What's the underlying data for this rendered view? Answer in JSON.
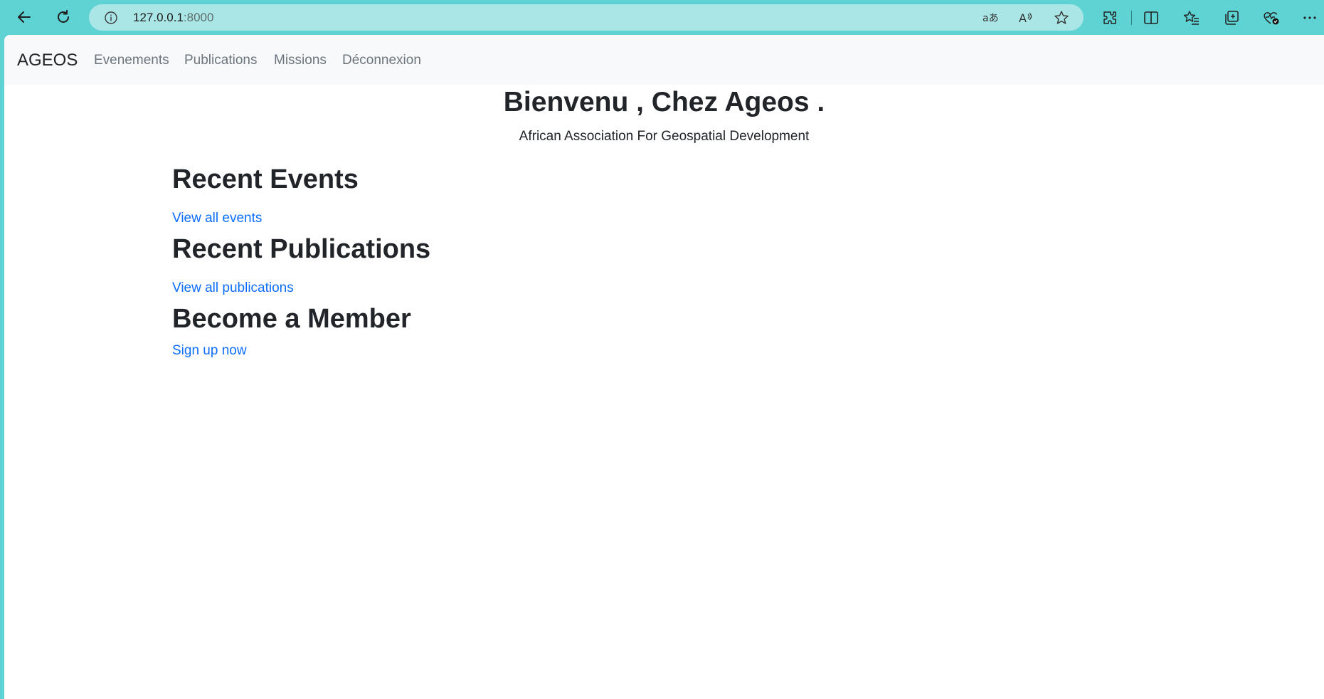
{
  "browser": {
    "url_host": "127.0.0.1",
    "url_port": ":8000"
  },
  "navbar": {
    "brand": "AGEOS",
    "links": [
      "Evenements",
      "Publications",
      "Missions",
      "Déconnexion"
    ]
  },
  "hero": {
    "title": "Bienvenu , Chez Ageos .",
    "subtitle": "African Association For Geospatial Development"
  },
  "sections": {
    "events": {
      "title": "Recent Events",
      "link": "View all events"
    },
    "publications": {
      "title": "Recent Publications",
      "link": "View all publications"
    },
    "member": {
      "title": "Become a Member",
      "link": "Sign up now"
    }
  },
  "colors": {
    "chrome": "#5fd3d3",
    "address_bar": "#a9e6e5",
    "navbar_bg": "#f8f9fa",
    "link": "#0d6efd",
    "nav_link": "#6c757d",
    "text": "#212529"
  }
}
